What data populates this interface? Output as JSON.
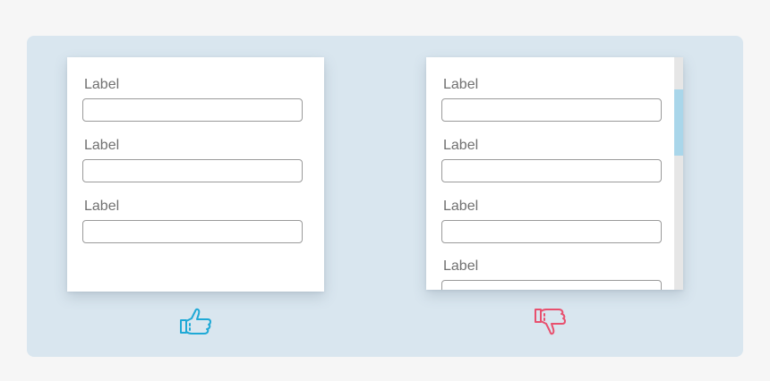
{
  "good_example": {
    "fields": [
      {
        "label": "Label",
        "value": ""
      },
      {
        "label": "Label",
        "value": ""
      },
      {
        "label": "Label",
        "value": ""
      }
    ],
    "verdict_icon": "thumbs-up-icon",
    "verdict_color": "#1fa9d6"
  },
  "bad_example": {
    "fields": [
      {
        "label": "Label",
        "value": ""
      },
      {
        "label": "Label",
        "value": ""
      },
      {
        "label": "Label",
        "value": ""
      },
      {
        "label": "Label",
        "value": ""
      }
    ],
    "verdict_icon": "thumbs-down-icon",
    "verdict_color": "#e8506e"
  },
  "colors": {
    "panel_background": "#d9e6ef",
    "scrollbar_thumb": "#a9d6ea"
  }
}
